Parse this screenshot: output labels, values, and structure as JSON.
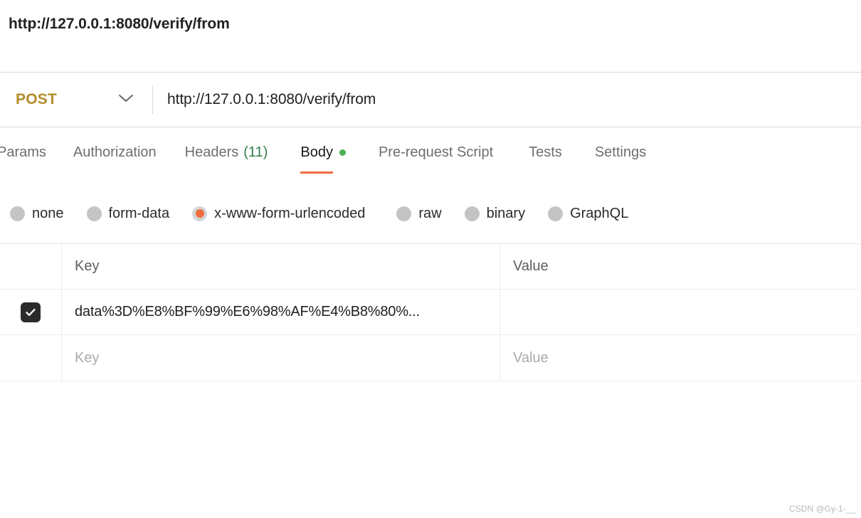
{
  "page_title": "http://127.0.0.1:8080/verify/from",
  "request_bar": {
    "method": "POST",
    "method_chevron_icon": "chevron-down-icon",
    "url": "http://127.0.0.1:8080/verify/from"
  },
  "tabs": [
    {
      "label": "Params",
      "count": "",
      "active": false,
      "dot": false
    },
    {
      "label": "Authorization",
      "count": "",
      "active": false,
      "dot": false
    },
    {
      "label": "Headers",
      "count": "(11)",
      "active": false,
      "dot": false
    },
    {
      "label": "Body",
      "count": "",
      "active": true,
      "dot": true
    },
    {
      "label": "Pre-request Script",
      "count": "",
      "active": false,
      "dot": false
    },
    {
      "label": "Tests",
      "count": "",
      "active": false,
      "dot": false
    },
    {
      "label": "Settings",
      "count": "",
      "active": false,
      "dot": false
    }
  ],
  "body_types": [
    {
      "label": "none",
      "selected": false
    },
    {
      "label": "form-data",
      "selected": false
    },
    {
      "label": "x-www-form-urlencoded",
      "selected": true
    },
    {
      "label": "raw",
      "selected": false
    },
    {
      "label": "binary",
      "selected": false
    },
    {
      "label": "GraphQL",
      "selected": false
    }
  ],
  "table": {
    "columns": {
      "key": "Key",
      "value": "Value"
    },
    "rows": [
      {
        "checked": true,
        "check_icon": "checkmark-icon",
        "key": "data%3D%E8%BF%99%E6%98%AF%E4%B8%80%...",
        "value": ""
      }
    ],
    "new_row": {
      "key_placeholder": "Key",
      "value_placeholder": "Value"
    }
  },
  "watermark": "CSDN @Gy-1-__",
  "colors": {
    "method_accent": "#b28c28",
    "active_tab_underline": "#ef6c3f",
    "radio_selected": "#ef6c3f",
    "count_green": "#2f7d46",
    "body_dot_green": "#4caf50"
  }
}
